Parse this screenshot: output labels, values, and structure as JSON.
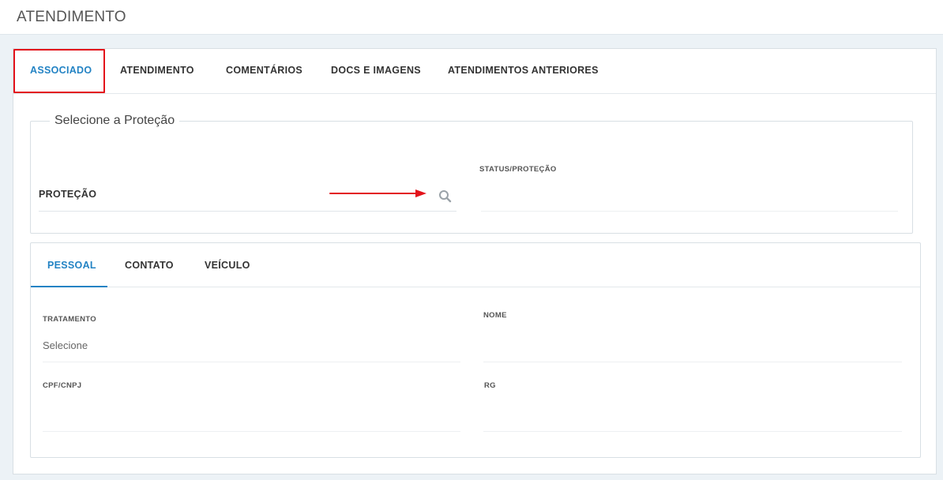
{
  "header": {
    "title": "ATENDIMENTO"
  },
  "tabs": [
    {
      "label": "ASSOCIADO"
    },
    {
      "label": "ATENDIMENTO"
    },
    {
      "label": "COMENTÁRIOS"
    },
    {
      "label": "DOCS E IMAGENS"
    },
    {
      "label": "ATENDIMENTOS ANTERIORES"
    }
  ],
  "protection_section": {
    "legend": "Selecione a Proteção",
    "protecao_label": "PROTEÇÃO",
    "status_label": "STATUS/PROTEÇÃO",
    "icons": {
      "search": "search-icon",
      "annotation": "red-arrow-icon"
    }
  },
  "sub_tabs": [
    {
      "label": "PESSOAL"
    },
    {
      "label": "CONTATO"
    },
    {
      "label": "VEÍCULO"
    }
  ],
  "personal_form": {
    "tratamento_label": "TRATAMENTO",
    "tratamento_value": "Selecione",
    "nome_label": "NOME",
    "cpf_label": "CPF/CNPJ",
    "rg_label": "RG"
  },
  "colors": {
    "accent": "#2383c4",
    "highlight": "#e3131b",
    "background": "#ecf2f6"
  }
}
